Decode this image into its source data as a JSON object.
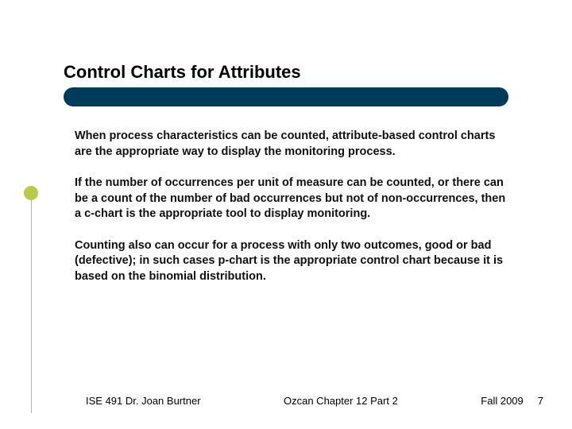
{
  "title": "Control Charts for Attributes",
  "paragraphs": {
    "p1": "When process characteristics can be counted, attribute-based control charts are the appropriate way to display the monitoring process.",
    "p2": "If the number of occurrences per unit of measure can be counted, or there can be a count of the number of bad occurrences but not of non-occurrences, then a c-chart is the appropriate tool to display monitoring.",
    "p3": "Counting also can occur for a process with only two outcomes, good or bad (defective); in such cases p-chart is the appropriate control chart because it is based on the binomial distribution."
  },
  "footer": {
    "left": "ISE 491  Dr. Joan Burtner",
    "center": "Ozcan Chapter 12 Part 2",
    "right": "Fall 2009",
    "page": "7"
  }
}
